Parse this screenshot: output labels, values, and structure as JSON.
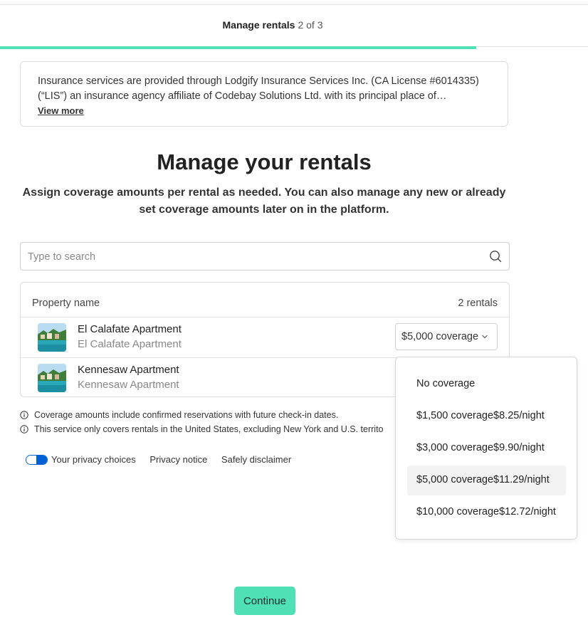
{
  "header": {
    "step_title": "Manage rentals",
    "step_count": "2 of 3",
    "progress_percent": 81
  },
  "notice": {
    "text": "Insurance services are provided through Lodgify Insurance Services Inc. (CA License #6014335) (“LIS”) an insurance agency affiliate of Codebay Solutions Ltd. with its principal place of…",
    "view_more": "View more"
  },
  "main": {
    "title": "Manage your rentals",
    "subtitle": "Assign coverage amounts per rental as needed. You can also manage any new or already set coverage amounts later on in the platform."
  },
  "search": {
    "placeholder": "Type to search",
    "value": ""
  },
  "table": {
    "col_name": "Property name",
    "count": "2 rentals",
    "rows": [
      {
        "title": "El Calafate Apartment",
        "subtitle": "El Calafate Apartment",
        "coverage": "$5,000 coverage"
      },
      {
        "title": "Kennesaw Apartment",
        "subtitle": "Kennesaw Apartment"
      }
    ]
  },
  "info": [
    "Coverage amounts include confirmed reservations with future check-in dates.",
    "This service only covers rentals in the United States, excluding New York and U.S. territo"
  ],
  "footer": {
    "privacy_choices": "Your privacy choices",
    "privacy_notice": "Privacy notice",
    "disclaimer": "Safely disclaimer"
  },
  "dropdown": {
    "options": [
      {
        "label": "No coverage",
        "price": ""
      },
      {
        "label": "$1,500 coverage",
        "price": "$8.25/night"
      },
      {
        "label": "$3,000 coverage",
        "price": "$9.90/night"
      },
      {
        "label": "$5,000 coverage",
        "price": "$11.29/night",
        "selected": true
      },
      {
        "label": "$10,000 coverage",
        "price": "$12.72/night"
      }
    ]
  },
  "continue_label": "Continue",
  "colors": {
    "accent": "#4fe0b5",
    "privacy_blue": "#0061d5"
  }
}
